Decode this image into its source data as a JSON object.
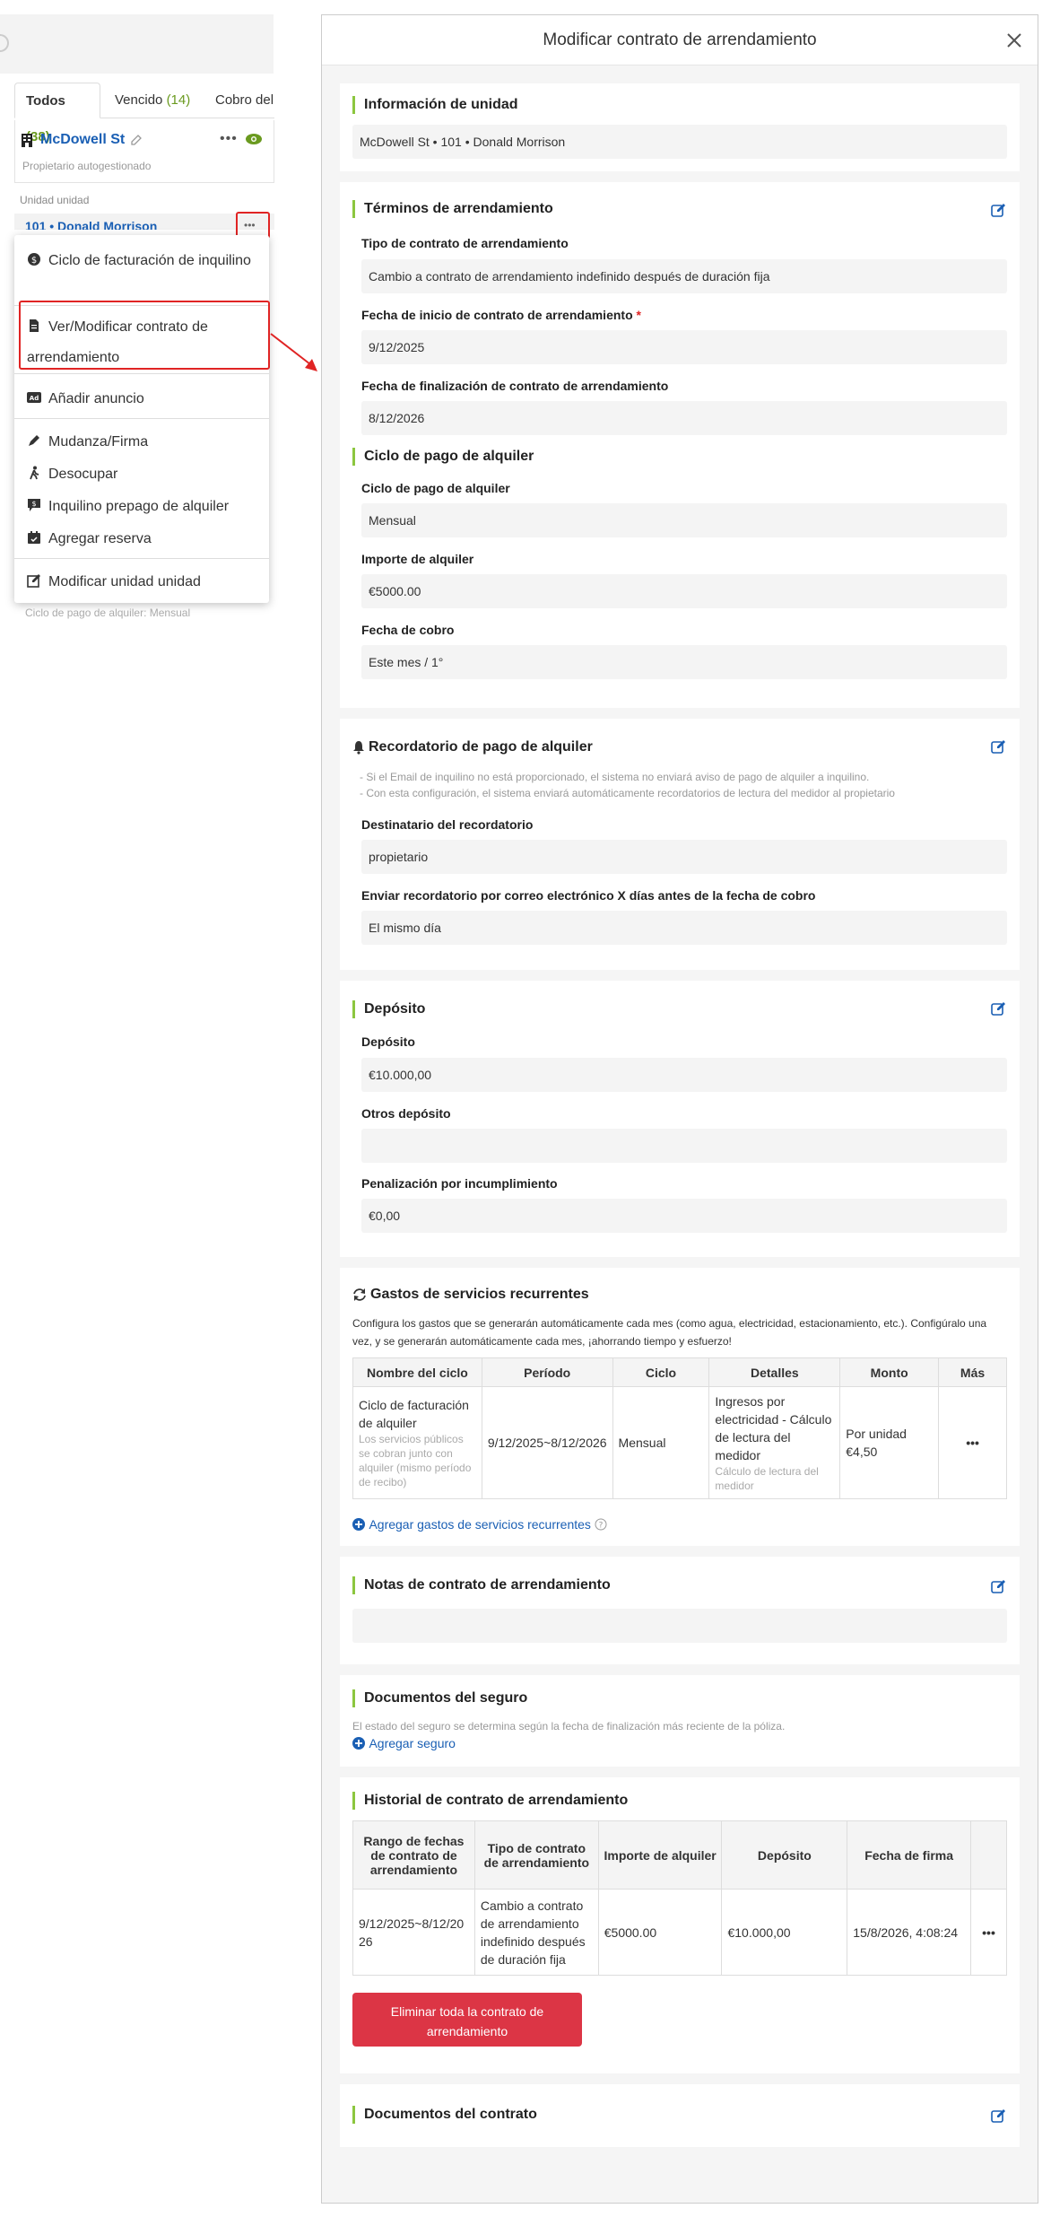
{
  "left": {
    "tabs": [
      {
        "label": "Todos",
        "count": "(38)"
      },
      {
        "label": "Vencido",
        "count": "(14)"
      },
      {
        "label": "Cobro del a",
        "count": ""
      }
    ],
    "property_name": "McDowell St",
    "property_subtitle": "Propietario autogestionado",
    "section_label": "Unidad unidad",
    "unit_row": "101 • Donald Morrison",
    "more_dots": "•••",
    "menu": [
      "Ciclo de facturación de inquilino",
      "Ver/Modificar contrato de arrendamiento",
      "Añadir anuncio",
      "Mudanza/Firma",
      "Desocupar",
      "Inquilino prepago de alquiler",
      "Agregar reserva",
      "Modificar unidad unidad"
    ],
    "footer_text": "Ciclo de pago de alquiler: Mensual"
  },
  "modal": {
    "title": "Modificar contrato de arrendamiento",
    "unit_info": {
      "title": "Información de unidad",
      "value": "McDowell St • 101 • Donald Morrison"
    },
    "terms": {
      "title": "Términos de arrendamiento",
      "type_label": "Tipo de contrato de arrendamiento",
      "type_value": "Cambio a contrato de arrendamiento indefinido después de duración fija",
      "start_label": "Fecha de inicio de contrato de arrendamiento",
      "start_req": "*",
      "start_value": "9/12/2025",
      "end_label": "Fecha de finalización de contrato de arrendamiento",
      "end_value": "8/12/2026"
    },
    "rent_cycle": {
      "title": "Ciclo de pago de alquiler",
      "cycle_label": "Ciclo de pago de alquiler",
      "cycle_value": "Mensual",
      "amount_label": "Importe de alquiler",
      "amount_value": "€5000.00",
      "due_label": "Fecha de cobro",
      "due_value": "Este mes / 1°"
    },
    "reminder": {
      "title": "Recordatorio de pago de alquiler",
      "note1": "- Si el Email de inquilino no está proporcionado, el sistema no enviará aviso de pago de alquiler a inquilino.",
      "note2": "- Con esta configuración, el sistema enviará automáticamente recordatorios de lectura del medidor al propietario",
      "recipient_label": "Destinatario del recordatorio",
      "recipient_value": "propietario",
      "days_label": "Enviar recordatorio por correo electrónico X días antes de la fecha de cobro",
      "days_value": "El mismo día"
    },
    "deposit": {
      "title": "Depósito",
      "deposit_label": "Depósito",
      "deposit_value": "€10.000,00",
      "other_label": "Otros depósito",
      "other_value": "",
      "penalty_label": "Penalización por incumplimiento",
      "penalty_value": "€0,00"
    },
    "recurring": {
      "title": "Gastos de servicios recurrentes",
      "note": "Configura los gastos que se generarán automáticamente cada mes (como agua, electricidad, estacionamiento, etc.). Configúralo una vez, y se generarán automáticamente cada mes, ¡ahorrando tiempo y esfuerzo!",
      "headers": [
        "Nombre del ciclo",
        "Período",
        "Ciclo",
        "Detalles",
        "Monto",
        "Más"
      ],
      "row": {
        "name": "Ciclo de facturación de alquiler",
        "name_sub": "Los servicios públicos se cobran junto con alquiler (mismo período de recibo)",
        "period": "9/12/2025~8/12/2026",
        "cycle": "Mensual",
        "details": "Ingresos por electricidad - Cálculo de lectura del medidor",
        "details_sub": "Cálculo de lectura del medidor",
        "amount": "Por unidad €4,50",
        "more": "•••"
      },
      "add_link": "Agregar gastos de servicios recurrentes"
    },
    "notes": {
      "title": "Notas de contrato de arrendamiento",
      "value": ""
    },
    "insurance": {
      "title": "Documentos del seguro",
      "note": "El estado del seguro se determina según la fecha de finalización más reciente de la póliza.",
      "add_link": "Agregar seguro"
    },
    "history": {
      "title": "Historial de contrato de arrendamiento",
      "headers": [
        "Rango de fechas de contrato de arrendamiento",
        "Tipo de contrato de arrendamiento",
        "Importe de alquiler",
        "Depósito",
        "Fecha de firma",
        ""
      ],
      "row": {
        "range": "9/12/2025~8/12/2026",
        "type": "Cambio a contrato de arrendamiento indefinido después de duración fija",
        "amount": "€5000.00",
        "deposit": "€10.000,00",
        "signed": "15/8/2026, 4:08:24",
        "more": "•••"
      },
      "delete_button": "Eliminar toda la contrato de arrendamiento"
    },
    "documents": {
      "title": "Documentos del contrato"
    }
  },
  "colors": {
    "accent_green": "#8cc63f",
    "link_blue": "#1a5fb4",
    "danger_red": "#dc3545",
    "callout_red": "#e02424"
  }
}
